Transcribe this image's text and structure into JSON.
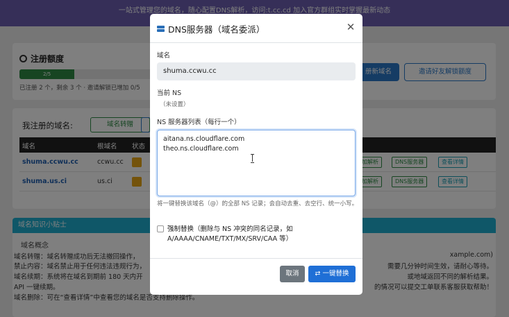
{
  "topbar": {
    "notice": "一站式管理您的域名，随心配置DNS解析，访问:t.cc.cd 加入官方群组实时掌握最新动态"
  },
  "quota_card": {
    "title": "注册额度",
    "progress_label": "2/5",
    "progress_value": 0.4,
    "summary": "已注册 2 个，剩余 3 个 · 邀请解锁已增加 0/5",
    "register_button": "册新域名",
    "invite_button": "邀请好友解锁额度"
  },
  "domains_card": {
    "title": "我注册的域名:",
    "transfer_button": "域名转赠",
    "columns": [
      "域名",
      "根域名",
      "状态"
    ],
    "rows": [
      {
        "domain": "shuma.ccwu.cc",
        "root": "ccwu.cc",
        "actions": [
          "加解析",
          "DNS服务器",
          "查看详情"
        ]
      },
      {
        "domain": "shuma.us.ci",
        "root": "us.ci",
        "actions": [
          "加解析",
          "DNS服务器",
          "查看详情"
        ]
      }
    ]
  },
  "tips_card": {
    "title": "域名知识小贴士",
    "subtitle": "域名概念",
    "lines": [
      {
        "left": "域名转赠：域名转赠成功后无法撤回操作，",
        "right": "xample.com)"
      },
      {
        "left": "禁止内容：域名禁止用于任何违法违规行为，",
        "right": "需要几分钟时间生效，请耐心等待。"
      },
      {
        "left": "域名续期：系统将在域名到期前 180 天内开",
        "right": "或地域返回不同的解析结果。"
      },
      {
        "left": "API 一键续期。",
        "right": "的情况可以提交工单联系客服获取帮助！"
      },
      {
        "left": "域名删除：可在“查看详情”中查看您的域名是否支持删除操作。",
        "right": ""
      }
    ]
  },
  "modal": {
    "title": "DNS服务器（域名委派）",
    "domain_label": "域名",
    "domain_value": "shuma.ccwu.cc",
    "current_ns_label": "当前 NS",
    "current_ns_value": "（未设置）",
    "ns_list_label": "NS 服务器列表（每行一个）",
    "ns_list_value": "aitana.ns.cloudflare.com\ntheo.ns.cloudflare.com",
    "help_text": "将一键替换该域名（@）的全部 NS 记录；会自动去重、去空行、统一小写。",
    "force_replace_label": "强制替换（删除与 NS 冲突的同名记录，如 A/AAAA/CNAME/TXT/MX/SRV/CAA 等）",
    "force_replace_checked": false,
    "cancel_button": "取消",
    "replace_button": "一键替换"
  }
}
